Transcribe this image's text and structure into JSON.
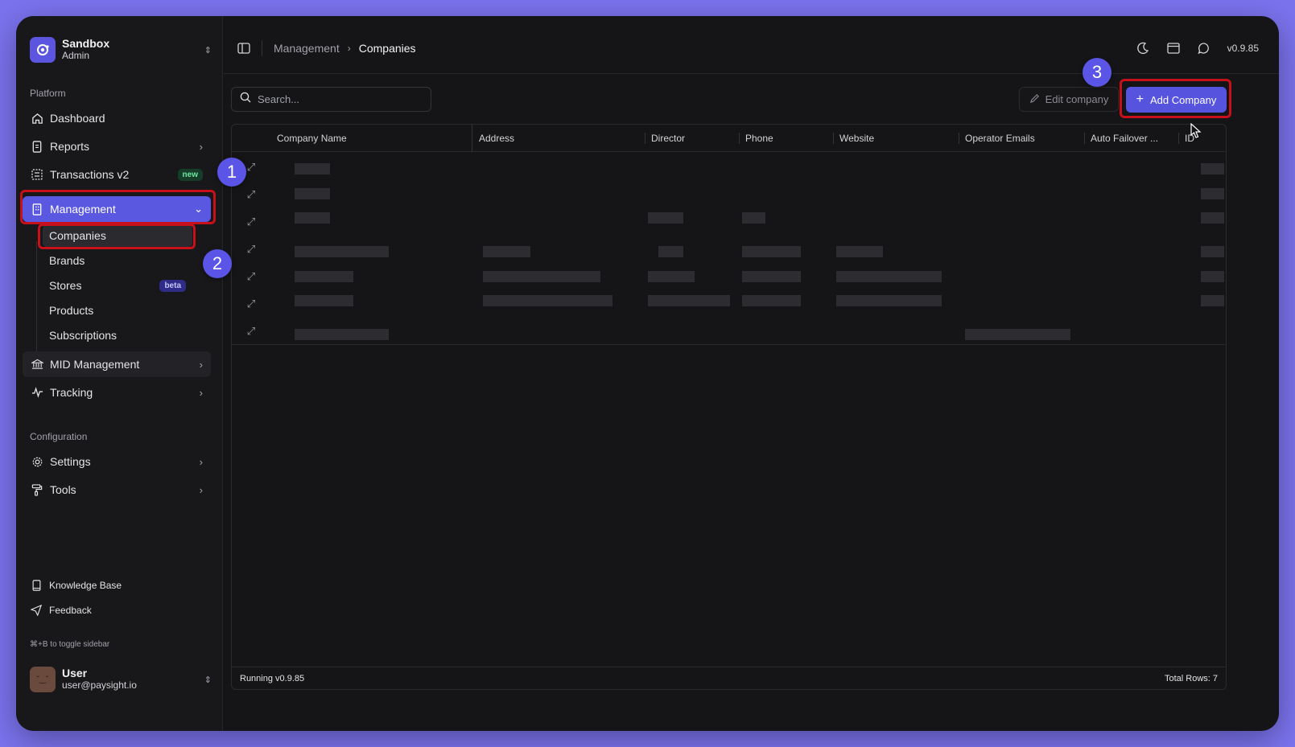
{
  "sidebar": {
    "org": {
      "name": "Sandbox",
      "role": "Admin"
    },
    "platform_label": "Platform",
    "items": [
      {
        "label": "Dashboard",
        "icon": "home-icon"
      },
      {
        "label": "Reports",
        "icon": "file-icon"
      },
      {
        "label": "Transactions v2",
        "icon": "list-icon",
        "badge": "new"
      },
      {
        "label": "Management",
        "icon": "building-icon"
      }
    ],
    "submenu": [
      {
        "label": "Companies"
      },
      {
        "label": "Brands"
      },
      {
        "label": "Stores",
        "badge": "beta"
      },
      {
        "label": "Products"
      },
      {
        "label": "Subscriptions"
      }
    ],
    "items_after": [
      {
        "label": "MID Management",
        "icon": "bank-icon"
      },
      {
        "label": "Tracking",
        "icon": "activity-icon"
      }
    ],
    "config_label": "Configuration",
    "config_items": [
      {
        "label": "Settings",
        "icon": "gear-icon"
      },
      {
        "label": "Tools",
        "icon": "paint-roller-icon"
      }
    ],
    "bottom_links": [
      {
        "label": "Knowledge Base",
        "icon": "book-icon"
      },
      {
        "label": "Feedback",
        "icon": "send-icon"
      }
    ],
    "hint": "⌘+B to toggle sidebar",
    "user": {
      "name": "User",
      "email": "user@paysight.io"
    }
  },
  "topbar": {
    "breadcrumb": {
      "parent": "Management",
      "current": "Companies"
    },
    "version": "v0.9.85"
  },
  "toolbar": {
    "search_placeholder": "Search...",
    "edit_label": "Edit company",
    "add_label": "Add Company"
  },
  "table": {
    "columns": [
      "Company Name",
      "Address",
      "Director",
      "Phone",
      "Website",
      "Operator Emails",
      "Auto Failover ...",
      "ID"
    ],
    "row_count": 7,
    "footer_running": "Running v0.9.85",
    "footer_total": "Total Rows: 7"
  },
  "annotations": {
    "step1": "1",
    "step2": "2",
    "step3": "3"
  },
  "colors": {
    "accent": "#5653df",
    "highlight": "#c8101a",
    "background": "#7b73ee"
  }
}
